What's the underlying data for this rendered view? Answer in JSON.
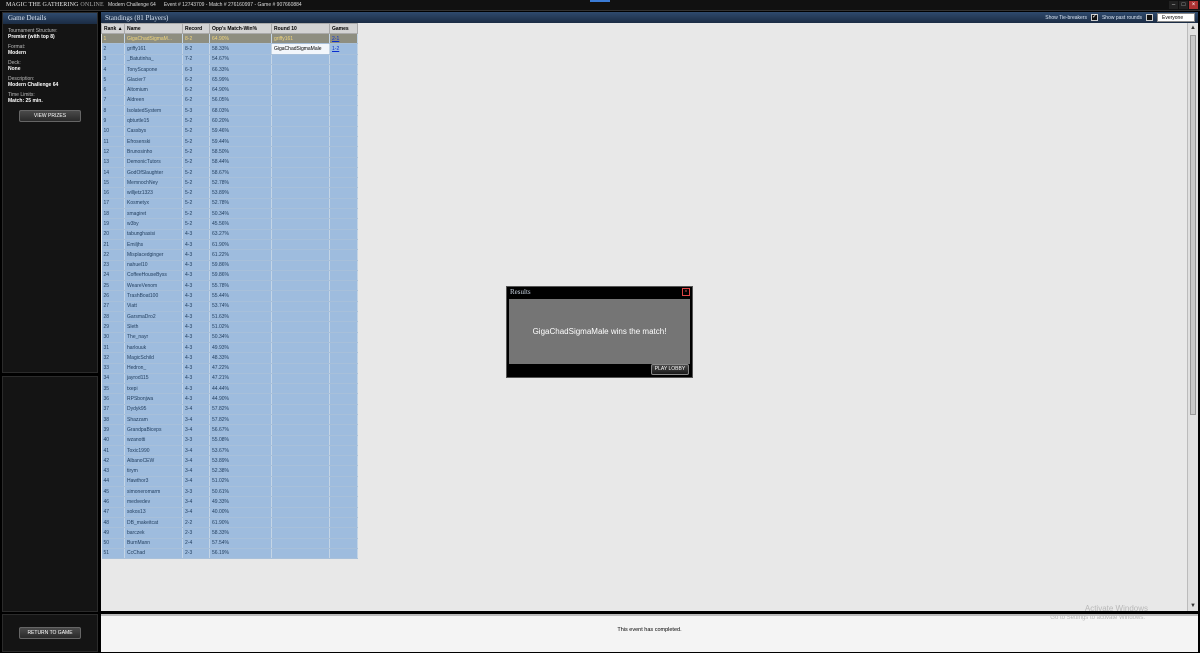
{
  "topbar": {
    "logo_main": "MAGIC THE GATHERING",
    "logo_online": "ONLINE",
    "event_name": "Modern Challenge 64",
    "ids": "Event # 12743709 - Match # 276160997 - Game # 907660884"
  },
  "left": {
    "title": "Game Details",
    "details": [
      {
        "label": "Tournament Structure:",
        "value": "Premier (with top 8)"
      },
      {
        "label": "Format:",
        "value": "Modern"
      },
      {
        "label": "Deck:",
        "value": "None"
      },
      {
        "label": "Description:",
        "value": "Modern Challenge 64"
      },
      {
        "label": "Time Limits:",
        "value": "Match: 25 min."
      }
    ],
    "view_prizes": "VIEW PRIZES",
    "return_to_game": "RETURN TO GAME"
  },
  "header": {
    "title": "Standings (81 Players)",
    "show_tiebreakers": "Show Tie-breakers",
    "show_past_rounds": "Show past rounds",
    "filter_value": "Everyone"
  },
  "table": {
    "columns": [
      "Rank",
      "Name",
      "Record",
      "Opp's Match-Win%",
      "Round 10",
      "Games"
    ],
    "rows": [
      {
        "rank": "1",
        "name": "GigaChadSigmaM...",
        "record": "8-2",
        "opp": "64.90%",
        "r10": "griffy161",
        "games": "2-1"
      },
      {
        "rank": "2",
        "name": "griffy161",
        "record": "8-2",
        "opp": "58.33%",
        "r10": "GigaChadSigmaMale",
        "games": "1-2"
      },
      {
        "rank": "3",
        "name": "_Batutinha_",
        "record": "7-2",
        "opp": "54.67%",
        "r10": "",
        "games": ""
      },
      {
        "rank": "4",
        "name": "TonyScapone",
        "record": "6-3",
        "opp": "66.33%",
        "r10": "",
        "games": ""
      },
      {
        "rank": "5",
        "name": "Glacier7",
        "record": "6-2",
        "opp": "65.99%",
        "r10": "",
        "games": ""
      },
      {
        "rank": "6",
        "name": "Altomium",
        "record": "6-2",
        "opp": "64.90%",
        "r10": "",
        "games": ""
      },
      {
        "rank": "7",
        "name": "Aldreen",
        "record": "6-2",
        "opp": "56.05%",
        "r10": "",
        "games": ""
      },
      {
        "rank": "8",
        "name": "IsolatedSystem",
        "record": "5-3",
        "opp": "68.03%",
        "r10": "",
        "games": ""
      },
      {
        "rank": "9",
        "name": "qbturtle15",
        "record": "5-2",
        "opp": "60.20%",
        "r10": "",
        "games": ""
      },
      {
        "rank": "10",
        "name": "Cassbys",
        "record": "5-2",
        "opp": "59.46%",
        "r10": "",
        "games": ""
      },
      {
        "rank": "11",
        "name": "Efrosenski",
        "record": "5-2",
        "opp": "59.44%",
        "r10": "",
        "games": ""
      },
      {
        "rank": "12",
        "name": "Brunosinho",
        "record": "5-2",
        "opp": "58.50%",
        "r10": "",
        "games": ""
      },
      {
        "rank": "13",
        "name": "DemonicTutors",
        "record": "5-2",
        "opp": "58.44%",
        "r10": "",
        "games": ""
      },
      {
        "rank": "14",
        "name": "GodOfSlaughter",
        "record": "5-2",
        "opp": "58.67%",
        "r10": "",
        "games": ""
      },
      {
        "rank": "15",
        "name": "MemnochNey",
        "record": "5-2",
        "opp": "52.78%",
        "r10": "",
        "games": ""
      },
      {
        "rank": "16",
        "name": "willjetz1323",
        "record": "5-2",
        "opp": "53.89%",
        "r10": "",
        "games": ""
      },
      {
        "rank": "17",
        "name": "Kosmetyx",
        "record": "5-2",
        "opp": "52.78%",
        "r10": "",
        "games": ""
      },
      {
        "rank": "18",
        "name": "smagiret",
        "record": "5-2",
        "opp": "50.34%",
        "r10": "",
        "games": ""
      },
      {
        "rank": "19",
        "name": "w3by",
        "record": "5-2",
        "opp": "45.56%",
        "r10": "",
        "games": ""
      },
      {
        "rank": "20",
        "name": "tabunghasisi",
        "record": "4-3",
        "opp": "63.27%",
        "r10": "",
        "games": ""
      },
      {
        "rank": "21",
        "name": "Emiljhs",
        "record": "4-3",
        "opp": "61.90%",
        "r10": "",
        "games": ""
      },
      {
        "rank": "22",
        "name": "Misplacedginger",
        "record": "4-3",
        "opp": "61.22%",
        "r10": "",
        "games": ""
      },
      {
        "rank": "23",
        "name": "nahuel10",
        "record": "4-3",
        "opp": "59.86%",
        "r10": "",
        "games": ""
      },
      {
        "rank": "24",
        "name": "CoffeeHouseByss",
        "record": "4-3",
        "opp": "59.86%",
        "r10": "",
        "games": ""
      },
      {
        "rank": "25",
        "name": "WeareVenom",
        "record": "4-3",
        "opp": "55.78%",
        "r10": "",
        "games": ""
      },
      {
        "rank": "26",
        "name": "TrashBoat100",
        "record": "4-3",
        "opp": "55.44%",
        "r10": "",
        "games": ""
      },
      {
        "rank": "27",
        "name": "Viatt",
        "record": "4-3",
        "opp": "53.74%",
        "r10": "",
        "games": ""
      },
      {
        "rank": "28",
        "name": "GarsmaDro2",
        "record": "4-3",
        "opp": "51.63%",
        "r10": "",
        "games": ""
      },
      {
        "rank": "29",
        "name": "Sleth",
        "record": "4-3",
        "opp": "51.02%",
        "r10": "",
        "games": ""
      },
      {
        "rank": "30",
        "name": "The_nayr",
        "record": "4-3",
        "opp": "50.34%",
        "r10": "",
        "games": ""
      },
      {
        "rank": "31",
        "name": "harlouuk",
        "record": "4-3",
        "opp": "49.93%",
        "r10": "",
        "games": ""
      },
      {
        "rank": "32",
        "name": "MagicSchild",
        "record": "4-3",
        "opp": "48.33%",
        "r10": "",
        "games": ""
      },
      {
        "rank": "33",
        "name": "Hedron_",
        "record": "4-3",
        "opp": "47.22%",
        "r10": "",
        "games": ""
      },
      {
        "rank": "34",
        "name": "jayrod115",
        "record": "4-3",
        "opp": "47.21%",
        "r10": "",
        "games": ""
      },
      {
        "rank": "35",
        "name": "txepi",
        "record": "4-3",
        "opp": "44.44%",
        "r10": "",
        "games": ""
      },
      {
        "rank": "36",
        "name": "RPSbonjwa",
        "record": "4-3",
        "opp": "44.90%",
        "r10": "",
        "games": ""
      },
      {
        "rank": "37",
        "name": "Dydyk95",
        "record": "3-4",
        "opp": "57.82%",
        "r10": "",
        "games": ""
      },
      {
        "rank": "38",
        "name": "Shazzam",
        "record": "3-4",
        "opp": "57.82%",
        "r10": "",
        "games": ""
      },
      {
        "rank": "39",
        "name": "GrandpaBiceps",
        "record": "3-4",
        "opp": "56.67%",
        "r10": "",
        "games": ""
      },
      {
        "rank": "40",
        "name": "wzanotti",
        "record": "3-3",
        "opp": "55.08%",
        "r10": "",
        "games": ""
      },
      {
        "rank": "41",
        "name": "Toxic1990",
        "record": "3-4",
        "opp": "53.67%",
        "r10": "",
        "games": ""
      },
      {
        "rank": "42",
        "name": "AlbanoCEW",
        "record": "3-4",
        "opp": "53.89%",
        "r10": "",
        "games": ""
      },
      {
        "rank": "43",
        "name": "tirym",
        "record": "3-4",
        "opp": "52.38%",
        "r10": "",
        "games": ""
      },
      {
        "rank": "44",
        "name": "Hawthor3",
        "record": "3-4",
        "opp": "51.02%",
        "r10": "",
        "games": ""
      },
      {
        "rank": "45",
        "name": "simoneromarm",
        "record": "3-3",
        "opp": "50.61%",
        "r10": "",
        "games": ""
      },
      {
        "rank": "46",
        "name": "medvedev",
        "record": "3-4",
        "opp": "49.33%",
        "r10": "",
        "games": ""
      },
      {
        "rank": "47",
        "name": "sokos13",
        "record": "3-4",
        "opp": "40.00%",
        "r10": "",
        "games": ""
      },
      {
        "rank": "48",
        "name": "DB_makeitcat",
        "record": "2-2",
        "opp": "61.90%",
        "r10": "",
        "games": ""
      },
      {
        "rank": "49",
        "name": "barczek",
        "record": "2-3",
        "opp": "58.33%",
        "r10": "",
        "games": ""
      },
      {
        "rank": "50",
        "name": "BurnMann",
        "record": "2-4",
        "opp": "57.54%",
        "r10": "",
        "games": ""
      },
      {
        "rank": "51",
        "name": "CcChad",
        "record": "2-3",
        "opp": "56.19%",
        "r10": "",
        "games": ""
      }
    ]
  },
  "modal": {
    "title": "Results",
    "message": "GigaChadSigmaMale wins the match!",
    "button": "PLAY LOBBY"
  },
  "status": {
    "text": "This event has completed."
  },
  "watermark": {
    "title": "Activate Windows",
    "subtitle": "Go to Settings to activate Windows."
  },
  "colors": {
    "row_bg": "#9ebcde",
    "highlight_row": "#8e8e80",
    "header_bar": "#2f4a6d"
  }
}
